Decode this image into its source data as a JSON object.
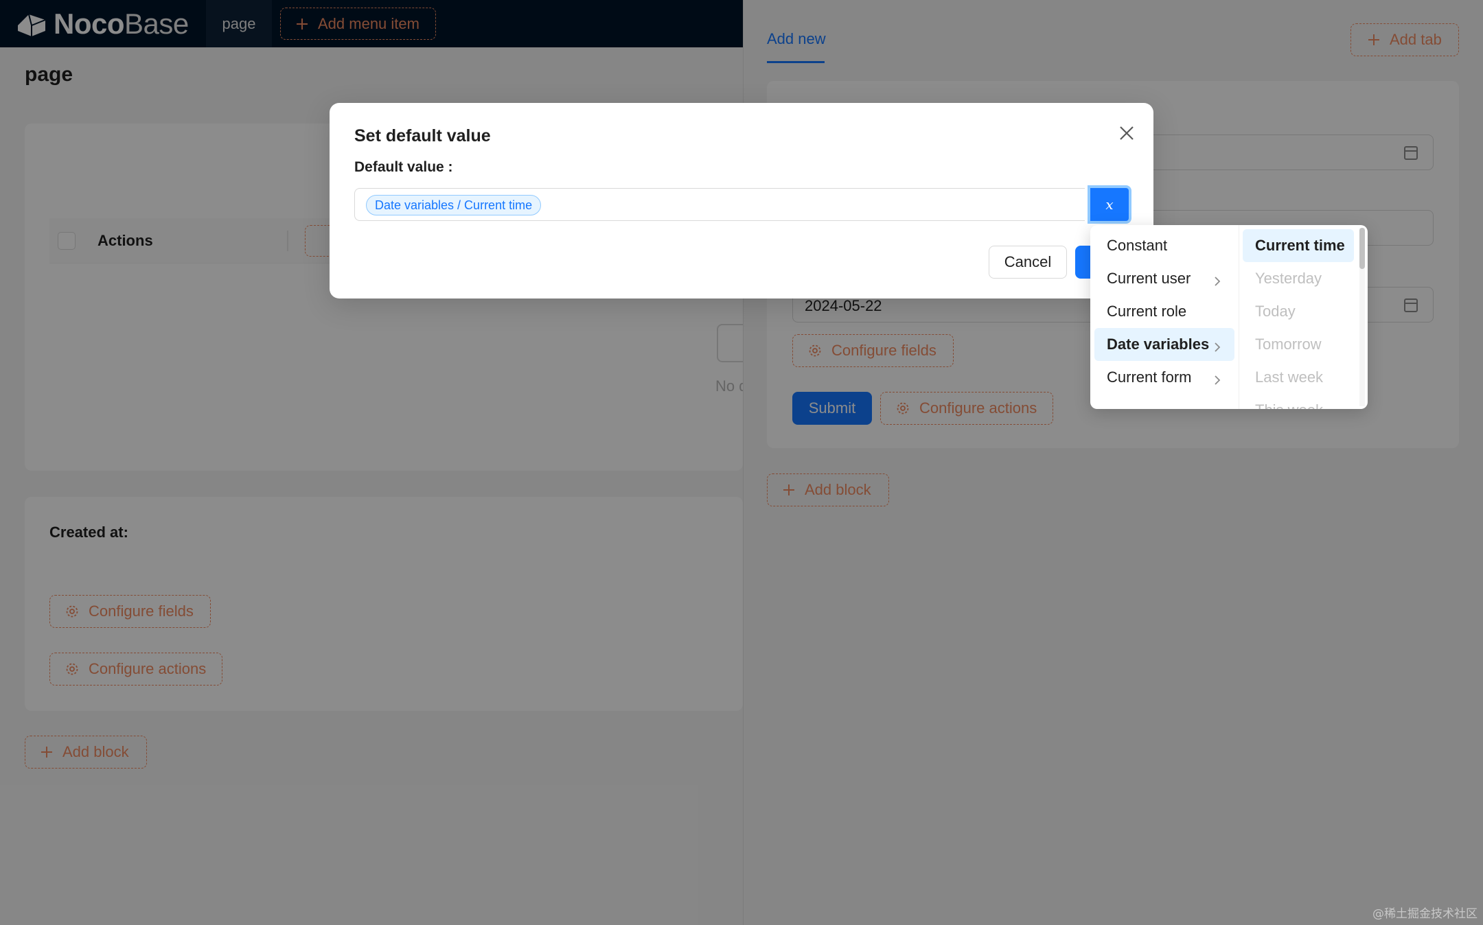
{
  "topbar": {
    "logo_bold": "Noco",
    "logo_thin": "Base",
    "active_tab": "page",
    "add_menu_item": "Add menu item"
  },
  "page": {
    "title": "page",
    "table_header_actions": "Actions",
    "empty_text": "No d",
    "created_at_label": "Created at",
    "configure_fields": "Configure fields",
    "configure_actions": "Configure actions",
    "add_block": "Add block"
  },
  "drawer": {
    "tab_add_new": "Add new",
    "add_tab": "Add tab",
    "date_value": "2024-05-22",
    "configure_fields": "Configure fields",
    "submit": "Submit",
    "configure_actions": "Configure actions",
    "add_block": "Add block"
  },
  "modal": {
    "title": "Set default value",
    "field_label": "Default value",
    "tag_value": "Date variables / Current time",
    "var_button": "x",
    "cancel": "Cancel"
  },
  "cascader": {
    "level1": [
      {
        "label": "Constant",
        "has_children": false
      },
      {
        "label": "Current user",
        "has_children": true
      },
      {
        "label": "Current role",
        "has_children": false
      },
      {
        "label": "Date variables",
        "has_children": true
      },
      {
        "label": "Current form",
        "has_children": true
      }
    ],
    "level2": [
      {
        "label": "Current time"
      },
      {
        "label": "Yesterday"
      },
      {
        "label": "Today"
      },
      {
        "label": "Tomorrow"
      },
      {
        "label": "Last week"
      },
      {
        "label": "This week"
      }
    ]
  },
  "watermark": "@稀土掘金技术社区",
  "colors": {
    "primary": "#1677ff",
    "dashed_orange": "#f18b62",
    "header_bg": "#001529"
  }
}
